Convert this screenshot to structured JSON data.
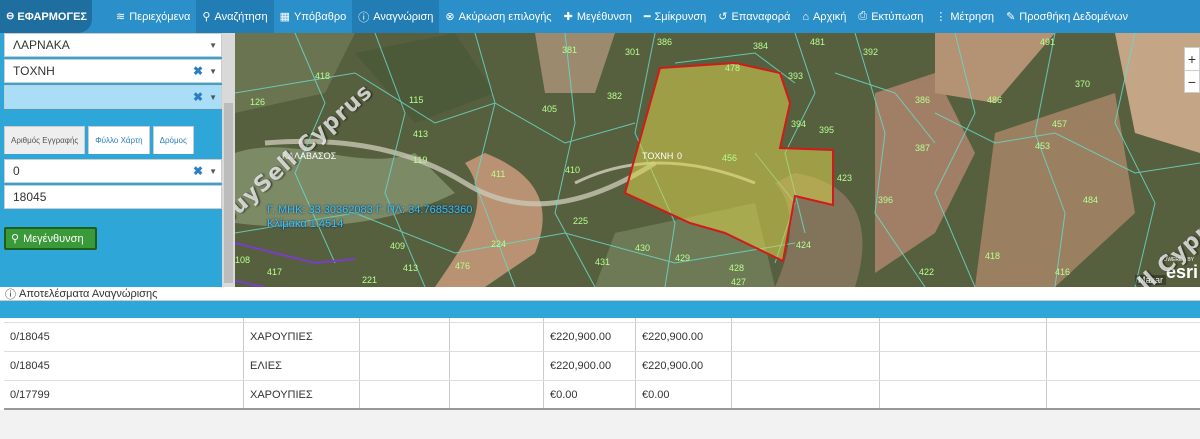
{
  "toolbar": {
    "apps_label": "ΕΦΑΡΜΟΓΕΣ",
    "items": [
      {
        "label": "Περιεχόμενα",
        "icon": "layers-icon"
      },
      {
        "label": "Αναζήτηση",
        "icon": "search-icon"
      },
      {
        "label": "Υπόβαθρο",
        "icon": "grid-icon"
      },
      {
        "label": "Αναγνώριση",
        "icon": "info-icon"
      },
      {
        "label": "Ακύρωση επιλογής",
        "icon": "cancel-icon"
      },
      {
        "label": "Μεγέθυνση",
        "icon": "plus-icon"
      },
      {
        "label": "Σμίκρυνση",
        "icon": "minus-icon"
      },
      {
        "label": "Επαναφορά",
        "icon": "reset-icon"
      },
      {
        "label": "Αρχική",
        "icon": "home-icon"
      },
      {
        "label": "Εκτύπωση",
        "icon": "print-icon"
      },
      {
        "label": "Μέτρηση",
        "icon": "ruler-icon"
      },
      {
        "label": "Προσθήκη Δεδομένων",
        "icon": "edit-icon"
      }
    ]
  },
  "left": {
    "district": "ΛΑΡΝΑΚΑ",
    "community": "ΤΟΧΝΗ",
    "field3": "",
    "tabs": [
      "Αριθμός Εγγραφής",
      "Φύλλο Χάρτη",
      "Δρόμος"
    ],
    "sheet_value": "0",
    "reg_value": "18045",
    "enlarge_label": "Μεγένθυνση"
  },
  "map": {
    "coords_line1": "Γ. ΜΗΚ: 33.30362083 Γ. ΠΛ: 34.76853360",
    "coords_line2": "Κλίμακα 1:4514",
    "label_village": "ΚΑΛΑΒΑΣΟΣ",
    "label_tochni": "ΤΟΧΝΗ",
    "label_zero": "0",
    "selected_parcel": "456",
    "parcels": [
      "381",
      "301",
      "386",
      "478",
      "384",
      "481",
      "392",
      "491",
      "382",
      "393",
      "394",
      "395",
      "418",
      "126",
      "115",
      "405",
      "413",
      "386",
      "486",
      "370",
      "457",
      "387",
      "453",
      "119",
      "411",
      "410",
      "423",
      "396",
      "484",
      "225",
      "224",
      "430",
      "424",
      "431",
      "476",
      "429",
      "428",
      "427",
      "221",
      "413",
      "422",
      "418",
      "416",
      "409",
      "108",
      "417"
    ],
    "attribution": "Maxar",
    "esri_text": "esri",
    "powered_text": "POWERED BY",
    "watermark": "BuySell Cyprus"
  },
  "results": {
    "title": "Αποτελέσματα Αναγνώρισης",
    "rows": [
      {
        "reg": "0/18045",
        "type": "ΧΑΡΟΥΠΙΕΣ",
        "c3": "",
        "c4": "",
        "v1": "€220,900.00",
        "v2": "€220,900.00"
      },
      {
        "reg": "0/18045",
        "type": "ΕΛΙΕΣ",
        "c3": "",
        "c4": "",
        "v1": "€220,900.00",
        "v2": "€220,900.00"
      },
      {
        "reg": "0/17799",
        "type": "ΧΑΡΟΥΠΙΕΣ",
        "c3": "",
        "c4": "",
        "v1": "€0.00",
        "v2": "€0.00"
      }
    ]
  }
}
